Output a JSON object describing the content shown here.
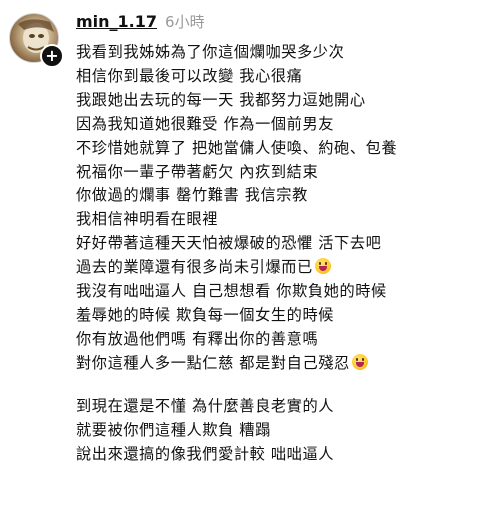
{
  "post": {
    "username": "min_1.17",
    "timestamp": "6小時"
  },
  "comment": {
    "paragraph1": [
      {
        "text": "我看到我姊姊為了你這個爛咖哭多少次"
      },
      {
        "text": "相信你到最後可以改變 我心很痛"
      },
      {
        "text": "我跟她出去玩的每一天 我都努力逗她開心"
      },
      {
        "text": "因為我知道她很難受 作為一個前男友"
      },
      {
        "text": "不珍惜她就算了 把她當傭人使喚、約砲、包養"
      },
      {
        "text": "祝福你一輩子帶著虧欠 內疚到結束"
      },
      {
        "text": "你做過的爛事 罄竹難書 我信宗教"
      },
      {
        "text": "我相信神明看在眼裡"
      },
      {
        "text": "好好帶著這種天天怕被爆破的恐懼 活下去吧"
      },
      {
        "text": "過去的業障還有很多尚未引爆而已",
        "emoji": "grinning-face-emoji"
      },
      {
        "text": "我沒有咄咄逼人 自己想想看 你欺負她的時候"
      },
      {
        "text": "羞辱她的時候 欺負每一個女生的時候"
      },
      {
        "text": "你有放過他們嗎 有釋出你的善意嗎"
      },
      {
        "text": "￼對你這種人多一點仁慈 都是對自己殘忍",
        "emoji": "grinning-face-emoji"
      }
    ],
    "paragraph2": [
      {
        "text": "到現在還是不懂 為什麼善良老實的人"
      },
      {
        "text": "就要被你們這種人欺負 糟蹋"
      },
      {
        "text": "說出來還搞的像我們愛計較 咄咄逼人"
      }
    ]
  },
  "icons": {
    "avatar": "profile-avatar",
    "add": "plus-icon",
    "emoji": "grinning-face-emoji"
  }
}
